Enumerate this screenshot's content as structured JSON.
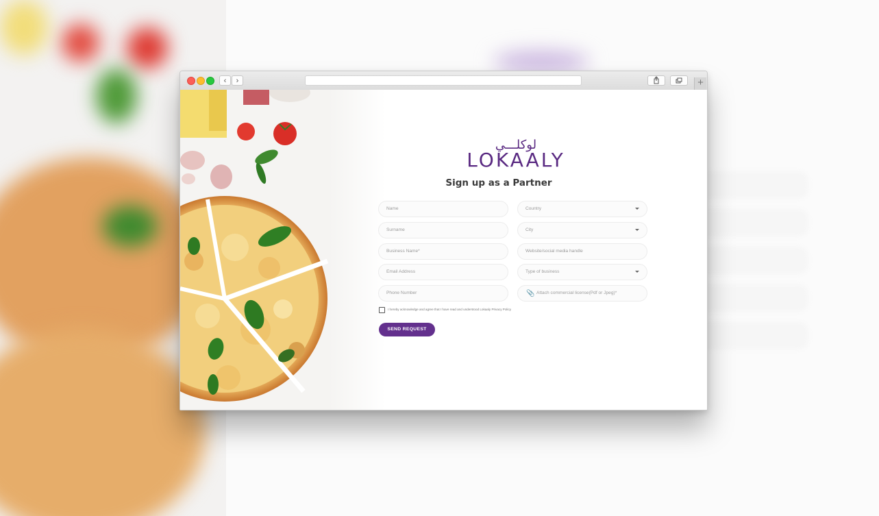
{
  "colors": {
    "brand_purple": "#5a2a82",
    "button_purple": "#63308d",
    "field_border": "#ececec",
    "placeholder_text": "#9a9a9a"
  },
  "browser": {
    "back_icon": "chevron-left-icon",
    "forward_icon": "chevron-right-icon",
    "share_icon": "share-icon",
    "tabs_icon": "tabs-icon",
    "new_tab_icon": "plus-icon"
  },
  "logo": {
    "arabic": "لوكلـــي",
    "english": "LOKAALY"
  },
  "page": {
    "title": "Sign up as a Partner"
  },
  "form": {
    "left_fields": [
      {
        "placeholder": "Name"
      },
      {
        "placeholder": "Surname"
      },
      {
        "placeholder": "Business Name*"
      },
      {
        "placeholder": "Email Address"
      },
      {
        "placeholder": "Phone Number"
      }
    ],
    "right_fields": [
      {
        "placeholder": "Country",
        "type": "select"
      },
      {
        "placeholder": "City",
        "type": "select"
      },
      {
        "placeholder": "Website/social media handle",
        "type": "text"
      },
      {
        "placeholder": "Type of business",
        "type": "select"
      },
      {
        "placeholder": "Attach commercial license(Pdf or Jpeg)*",
        "type": "file"
      }
    ],
    "consent_text": "I hereby acknowledge and agree that I have read and understood Lokaaly Privacy Policy",
    "consent_checked": false,
    "submit_label": "SEND REQUEST"
  }
}
